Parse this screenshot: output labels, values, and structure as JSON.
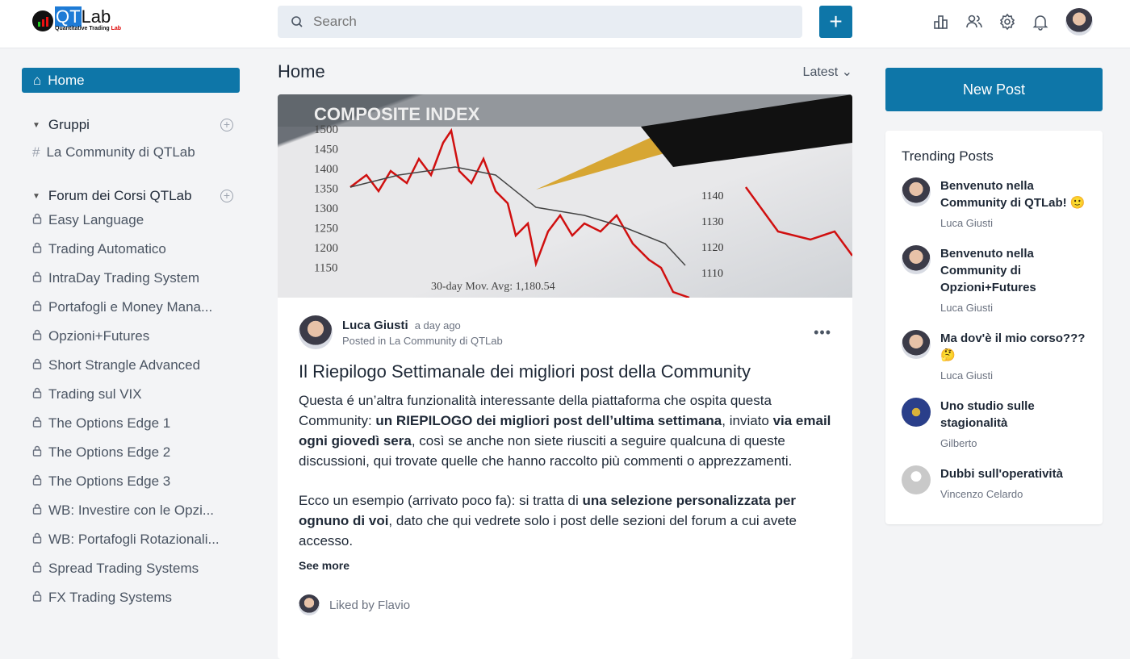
{
  "header": {
    "logo_qt": "QT",
    "logo_lab": "Lab",
    "logo_sub": "Quantitative Trading",
    "logo_sub2": "Lab",
    "search_placeholder": "Search"
  },
  "sidebar": {
    "home": "Home",
    "groups": [
      {
        "label": "Gruppi",
        "items": [
          "La Community di QTLab"
        ]
      },
      {
        "label": "Forum dei Corsi QTLab",
        "items": [
          "Easy Language",
          "Trading Automatico",
          "IntraDay Trading System",
          "Portafogli e Money Mana...",
          "Opzioni+Futures",
          "Short Strangle Advanced",
          "Trading sul VIX",
          "The Options Edge 1",
          "The Options Edge 2",
          "The Options Edge 3",
          "WB: Investire con le Opzi...",
          "WB: Portafogli Rotazionali...",
          "Spread Trading Systems",
          "FX Trading Systems"
        ]
      }
    ]
  },
  "main": {
    "title": "Home",
    "sort": "Latest",
    "post": {
      "author": "Luca Giusti",
      "time": "a day ago",
      "posted_in": "Posted in La Community di QTLab",
      "title": "Il Riepilogo Settimanale dei migliori post della Community",
      "p1": [
        "Questa é un’altra funzionalità interessante della piattaforma che ospita questa Community: ",
        "un RIEPILOGO dei migliori post dell’ultima settimana",
        ", inviato ",
        "via email ogni giovedì sera",
        ", così se anche non siete riusciti a seguire qualcuna di queste discussioni, qui trovate quelle che hanno raccolto più commenti o apprezzamenti."
      ],
      "p2": [
        "Ecco un esempio (arrivato poco fa): si tratta di ",
        "una selezione personalizzata per ognuno di voi",
        ", dato che qui vedrete solo i post delle sezioni del forum a cui avete accesso."
      ],
      "see_more": "See more",
      "liked": "Liked by Flavio",
      "image_text": {
        "header": "COMPOSITE INDEX",
        "ticks": [
          "1500",
          "1450",
          "1400",
          "1350",
          "1300",
          "1250",
          "1200",
          "1150"
        ],
        "right_ticks": [
          "1140",
          "1130",
          "1120",
          "1110"
        ],
        "caption": "30-day Mov. Avg: 1,180.54"
      }
    }
  },
  "right": {
    "new_post": "New Post",
    "trending_title": "Trending Posts",
    "trending": [
      {
        "title": "Benvenuto nella Community di QTLab! 🙂",
        "author": "Luca Giusti",
        "avatar": "luca"
      },
      {
        "title": "Benvenuto nella Community di Opzioni+Futures",
        "author": "Luca Giusti",
        "avatar": "luca"
      },
      {
        "title": "Ma dov'è il mio corso??? 🤔",
        "author": "Luca Giusti",
        "avatar": "luca"
      },
      {
        "title": "Uno studio sulle stagionalità",
        "author": "Gilberto",
        "avatar": "g"
      },
      {
        "title": "Dubbi sull'operatività",
        "author": "Vincenzo Celardo",
        "avatar": "v"
      }
    ]
  },
  "colors": {
    "accent": "#0e76a8"
  }
}
